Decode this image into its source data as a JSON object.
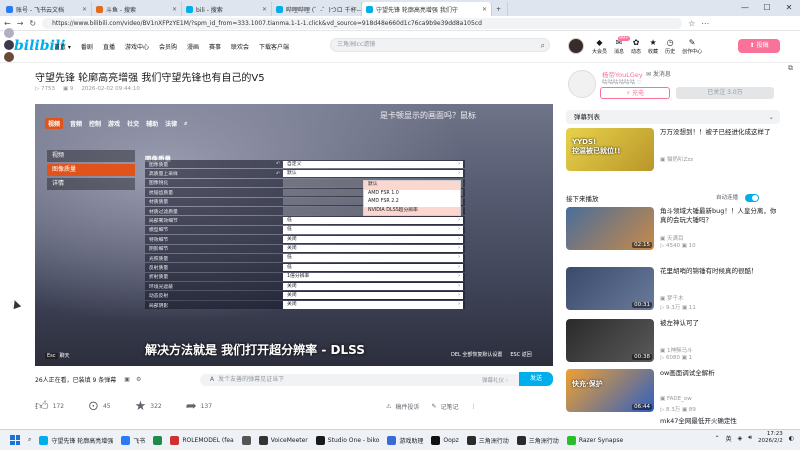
{
  "browser": {
    "tabs": [
      {
        "label": "账号 - 飞书云文档",
        "color": "#2a7bf4"
      },
      {
        "label": "斗鱼 - 搜索",
        "color": "#e36b1a"
      },
      {
        "label": "bili - 搜索",
        "color": "#00aeec"
      },
      {
        "label": "哔哩哔哩 (゜-゜)つロ 千杯--bilibili",
        "color": "#00aeec"
      },
      {
        "label": "守望先锋 轮廓高亮增强 我们守",
        "color": "#00aeec",
        "active": true
      }
    ],
    "url": "https://www.bilibili.com/video/BV1nXFPzYE1M/?spm_id_from=333.1007.tianma.1-1-1.click&vd_source=918d48e660d1c76ca9b9e39dd8a105cd"
  },
  "header": {
    "logo": "bilibili",
    "nav": [
      "首页 ▾",
      "番剧",
      "直播",
      "游戏中心",
      "会员购",
      "漫画",
      "赛事",
      "联欢会",
      "下载客户端"
    ],
    "search_placeholder": "三角洲lcc滤镜",
    "right_nav": [
      {
        "icon": "◆",
        "label": "大会员"
      },
      {
        "icon": "✉",
        "label": "消息"
      },
      {
        "icon": "✿",
        "label": "动态"
      },
      {
        "icon": "★",
        "label": "收藏"
      },
      {
        "icon": "◷",
        "label": "历史"
      },
      {
        "icon": "✎",
        "label": "创作中心"
      }
    ],
    "badge_count": "99+",
    "upload_label": "⬆ 投稿"
  },
  "video": {
    "title": "守望先锋 轮廓高亮增强 我们守望先锋也有自己的V5",
    "views": "▷ 7753",
    "danmaku_count": "▣ 9",
    "date": "2026-02-02 09:44:10",
    "online": "26人正在看，已装填 9 条弹幕",
    "danmaku_placeholder": "发个友善的弹幕见证当下",
    "etiquette": "弹幕礼仪 ›",
    "send_label": "发送",
    "likes": "172",
    "coins": "45",
    "favorites": "322",
    "shares": "137",
    "report": "稿件投诉",
    "notes": "记笔记"
  },
  "game": {
    "tabs": [
      "视频",
      "音频",
      "控制",
      "游戏",
      "社交",
      "辅助",
      "法律"
    ],
    "danmaku_overlay": "是卡顿显示的画面吗？鼠标",
    "side": [
      "视频",
      "图像质量",
      "详情"
    ],
    "panel_title": "图像质量",
    "rows": [
      {
        "name": "图像质量",
        "value": "自定义"
      },
      {
        "name": "高质量上采样",
        "value": "默认"
      },
      {
        "name": "图像锐化",
        "value": ""
      },
      {
        "name": "抗锯齿质量",
        "value": ""
      },
      {
        "name": "材质质量",
        "value": ""
      },
      {
        "name": "材质过滤质量",
        "value": ""
      },
      {
        "name": "局部雾效细节",
        "value": "低"
      },
      {
        "name": "模型细节",
        "value": "低"
      },
      {
        "name": "特效细节",
        "value": "关闭"
      },
      {
        "name": "阴影细节",
        "value": "关闭"
      },
      {
        "name": "光照质量",
        "value": "低"
      },
      {
        "name": "反射质量",
        "value": "低"
      },
      {
        "name": "折射质量",
        "value": "1倍分辨率"
      },
      {
        "name": "环境光遮蔽",
        "value": "关闭"
      },
      {
        "name": "动态反射",
        "value": "关闭"
      },
      {
        "name": "局部阴影",
        "value": "关闭"
      }
    ],
    "dropdown": [
      "默认",
      "AMD FSR 1.0",
      "AMD FSR 2.2",
      "NVIDIA DLSS超分辨率"
    ],
    "subtitle": "解决方法就是 我们打开超分辨率 - DLSS",
    "bottom_left_key": "Esc",
    "bottom_left": "聊天",
    "bottom_right": [
      "DEL 全部恢复默认设置",
      "ESC 返回"
    ]
  },
  "uploader": {
    "name": "杨帝YouLGey",
    "message": "✉ 发消息",
    "sign": "咕咕咕咕咕咕 ♡",
    "charge": "⚡ 充电",
    "follow": "已关注 3.0万"
  },
  "sidebar": {
    "danmaku_list": "弹幕列表",
    "danmaku_list_toggle": "⌄",
    "next_label": "接下来播放",
    "autoplay_label": "自动连播",
    "videos": [
      {
        "title": "万万没想到！！被子已经进化成这样了",
        "up": "▣ 猫奶叭Zzz",
        "stats": "",
        "dur": "",
        "theme": "yellow",
        "tag": "YYDS!\n控温被已就位!!"
      },
      {
        "title": "角斗领域大锤最新bug！！人皇分离，你真的会玩大锤吗？",
        "up": "▣ 天满目",
        "stats": "▷ 4540  ▣ 10",
        "dur": "02:15",
        "theme": "ow",
        "tag": ""
      },
      {
        "title": "花里胡哨的锦锤有时候真的很酷！",
        "up": "▣ 梦千木",
        "stats": "▷ 9.3万  ▣ 11",
        "dur": "00:31",
        "theme": "ow2",
        "tag": ""
      },
      {
        "title": "被左神认可了",
        "up": "▣ 1神稣马斗",
        "stats": "▷ 6080  ▣ 1",
        "dur": "00:38",
        "theme": "dark",
        "tag": ""
      },
      {
        "title": "ow画面调试全解析",
        "up": "▣ FADE_ow",
        "stats": "▷ 8.3万  ▣ 89",
        "dur": "06:44",
        "theme": "poster",
        "tag": "快充·保护"
      },
      {
        "title": "mk47全网最低开火确定性",
        "up": "",
        "stats": "",
        "dur": "",
        "theme": "",
        "tag": ""
      }
    ]
  },
  "taskbar": {
    "items": [
      {
        "label": "守望先锋 轮廓高亮增强",
        "color": "#00aeec"
      },
      {
        "label": "飞书",
        "color": "#2a7bf4"
      },
      {
        "label": "",
        "color": "#1f8a4c"
      },
      {
        "label": "ROLEMODEL (fea",
        "color": "#d03030"
      },
      {
        "label": "",
        "color": "#555"
      },
      {
        "label": "VoiceMeeter",
        "color": "#333"
      },
      {
        "label": "Studio One - biko",
        "color": "#1a1a1a"
      },
      {
        "label": "游戏助理",
        "color": "#3a6ad4"
      },
      {
        "label": "Oopz",
        "color": "#111"
      },
      {
        "label": "三角洲行动",
        "color": "#2a2a2a"
      },
      {
        "label": "三角洲行动",
        "color": "#2a2a2a"
      },
      {
        "label": "Razer Synapse",
        "color": "#2bbd2b"
      }
    ],
    "lang": "英",
    "time": "17:23",
    "date": "2026/2/2"
  }
}
